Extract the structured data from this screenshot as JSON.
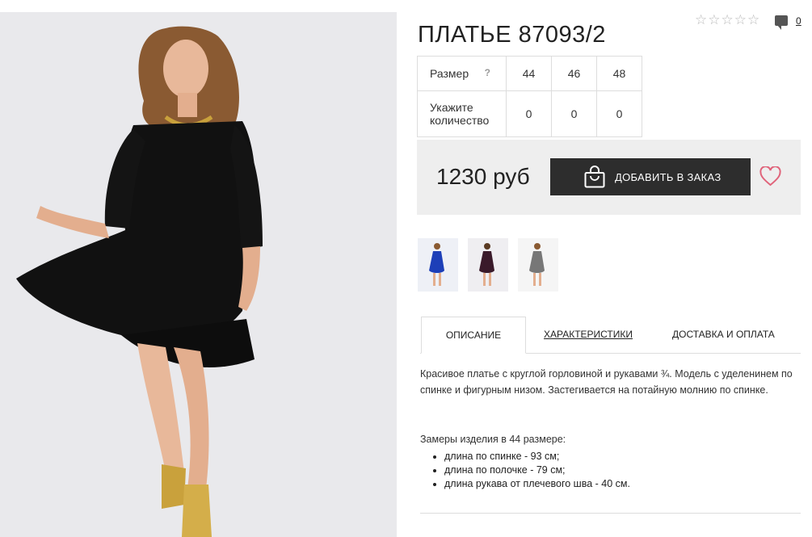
{
  "product": {
    "title": "ПЛАТЬЕ 87093/2",
    "rating_stars": 5,
    "rating_filled": 0,
    "comments_count": "0"
  },
  "sizes": {
    "size_label": "Размер",
    "help_icon": "?",
    "size_values": [
      "44",
      "46",
      "48"
    ],
    "qty_label_line1": "Укажите",
    "qty_label_line2": "количество",
    "qty_values": [
      "0",
      "0",
      "0"
    ]
  },
  "purchase": {
    "price": "1230 руб",
    "add_button_label": "ДОБАВИТЬ В ЗАКАЗ",
    "cart_icon": "shopping-bag-icon",
    "wishlist_icon": "heart-icon"
  },
  "thumbnails": [
    {
      "dress_color": "#1d3fb8",
      "bg": "#eef0f6"
    },
    {
      "dress_color": "#3a1a2a",
      "bg": "#efeef1"
    },
    {
      "dress_color": "#777777",
      "bg": "#f5f5f5"
    }
  ],
  "tabs": [
    "ОПИСАНИЕ",
    "ХАРАКТЕРИСТИКИ",
    "ДОСТАВКА И ОПЛАТА"
  ],
  "description": {
    "text": "Красивое платье с круглой горловиной и рукавами ¾. Модель с уделенинем по спинке и фигурным низом. Застегивается на потайную молнию по спинке.",
    "measurements_title": "Замеры изделия в 44 размере:",
    "measurements": [
      "длина по спинке - 93 см;",
      "длина по полочке - 79 см;",
      "длина рукава от плечевого шва - 40 см."
    ]
  },
  "colors": {
    "button_bg": "#2d2d2d",
    "price_box_bg": "#eeeeee",
    "heart": "#e0637a",
    "photo_bg": "#e9e9ec"
  }
}
